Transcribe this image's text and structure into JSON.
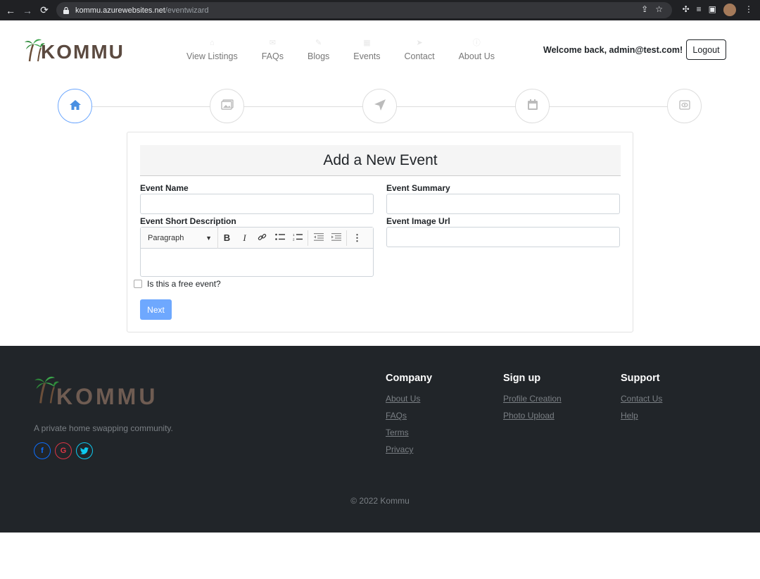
{
  "browser": {
    "url_host": "kommu.azurewebsites.net",
    "url_path": "/eventwizard"
  },
  "header": {
    "logo_text": "KOMMU",
    "nav": [
      {
        "label": "View Listings",
        "icon": "home-icon"
      },
      {
        "label": "FAQs",
        "icon": "chat-icon"
      },
      {
        "label": "Blogs",
        "icon": "pen-icon"
      },
      {
        "label": "Events",
        "icon": "calendar-icon"
      },
      {
        "label": "Contact",
        "icon": "paper-plane-icon"
      },
      {
        "label": "About Us",
        "icon": "info-icon"
      }
    ],
    "welcome": "Welcome back, admin@test.com!",
    "logout_label": "Logout"
  },
  "stepper": {
    "steps": [
      "home-icon",
      "images-icon",
      "paper-plane-icon",
      "calendar-icon",
      "eye-icon"
    ],
    "active_index": 0,
    "accent": "#4a90e2"
  },
  "form": {
    "title": "Add a New Event",
    "event_name_label": "Event Name",
    "event_name_value": "",
    "event_summary_label": "Event Summary",
    "event_summary_value": "",
    "short_desc_label": "Event Short Description",
    "editor_format": "Paragraph",
    "image_url_label": "Event Image Url",
    "image_url_value": "",
    "free_event_label": "Is this a free event?",
    "free_event_checked": false,
    "next_label": "Next",
    "next_color": "#6ea8fe"
  },
  "footer": {
    "logo_text": "KOMMU",
    "tagline": "A private home swapping community.",
    "socials": [
      {
        "name": "facebook-icon",
        "glyph": "f",
        "color": "#0d6efd"
      },
      {
        "name": "google-icon",
        "glyph": "G",
        "color": "#dc3545"
      },
      {
        "name": "twitter-icon",
        "glyph": "t",
        "color": "#0dcaf0"
      }
    ],
    "columns": [
      {
        "title": "Company",
        "links": [
          "About Us",
          "FAQs",
          "Terms",
          "Privacy"
        ]
      },
      {
        "title": "Sign up",
        "links": [
          "Profile Creation",
          "Photo Upload"
        ]
      },
      {
        "title": "Support",
        "links": [
          "Contact Us",
          "Help"
        ]
      }
    ],
    "copyright": "© 2022 Kommu"
  }
}
